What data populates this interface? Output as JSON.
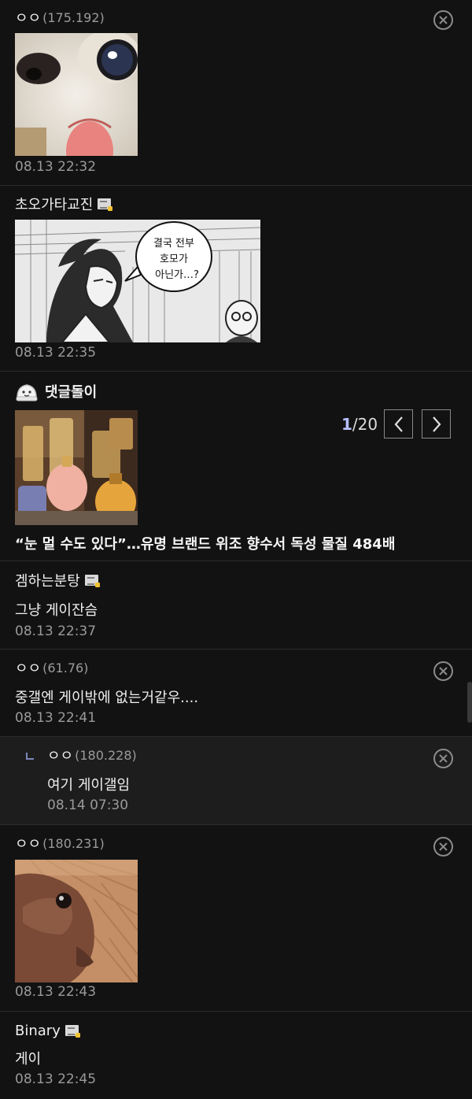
{
  "comments": [
    {
      "name": "ㅇㅇ",
      "ip": "(175.192)",
      "time": "08.13 22:32"
    },
    {
      "name": "초오가타교진",
      "time": "08.13 22:35",
      "manga_bubble": [
        "결국 전부",
        "호모가",
        "아닌가…?"
      ]
    },
    {
      "name": "겜하는분탕",
      "text": "그냥 게이잔슴",
      "time": "08.13 22:37"
    },
    {
      "name": "ㅇㅇ",
      "ip": "(61.76)",
      "text": "중갤엔 게이밖에 없는거같우....",
      "time": "08.13 22:41"
    },
    {
      "name": "ㅇㅇ",
      "ip": "(180.228)",
      "text": "여기 게이갤임",
      "time": "08.14 07:30"
    },
    {
      "name": "ㅇㅇ",
      "ip": "(180.231)",
      "time": "08.13 22:43"
    },
    {
      "name": "Binary",
      "text": "게이",
      "time": "08.13 22:45"
    }
  ],
  "ad": {
    "title": "댓글돌이",
    "page_current": "1",
    "page_total": "/20",
    "headline": "“눈 멀 수도 있다”…유명 브랜드 위조 향수서 독성 물질 484배"
  },
  "icons": {
    "delete": "circle-x-icon",
    "fixed_nick": "fixed-nickname-icon",
    "reply": "reply-arrow-icon",
    "bot": "dumpling-bot-icon",
    "prev": "chevron-left-icon",
    "next": "chevron-right-icon"
  },
  "colors": {
    "background": "#121212",
    "reply_background": "#1d1d1d",
    "accent": "#b7c0ff"
  }
}
